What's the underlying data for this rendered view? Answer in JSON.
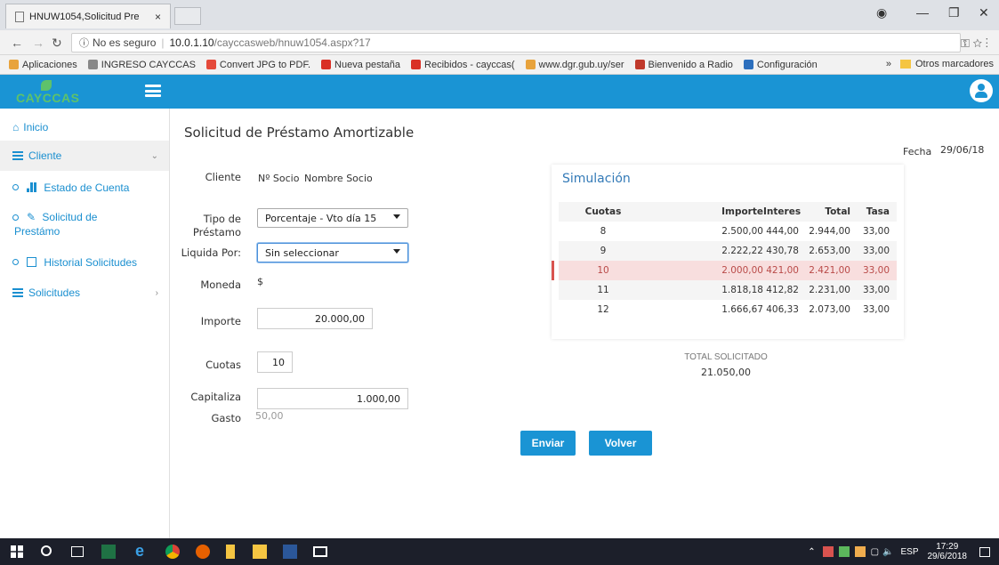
{
  "browser": {
    "tab_title": "HNUW1054,Solicitud Pre",
    "tab_close": "×",
    "security_label": "No es seguro",
    "url_host": "10.0.1.10",
    "url_path": "/cayccasweb/hnuw1054.aspx?17",
    "bookmarks": [
      {
        "label": "Aplicaciones",
        "color": "#e8a33c"
      },
      {
        "label": "INGRESO CAYCCAS",
        "color": "#888888"
      },
      {
        "label": "Convert JPG to PDF.",
        "color": "#e54a3a"
      },
      {
        "label": "Nueva pestaña",
        "color": "#d93025"
      },
      {
        "label": "Recibidos - cayccas(",
        "color": "#d93025"
      },
      {
        "label": "www.dgr.gub.uy/ser",
        "color": "#e8a33c"
      },
      {
        "label": "Bienvenido a Radio",
        "color": "#c0392b"
      },
      {
        "label": "Configuración",
        "color": "#2c6fbd"
      }
    ],
    "bookmarks_overflow": "»",
    "other_bookmarks": "Otros marcadores"
  },
  "app": {
    "logo": "CAYCCAS",
    "brand_color": "#1a94d4"
  },
  "sidebar": {
    "inicio": "Inicio",
    "cliente": "Cliente",
    "estado_cuenta": "Estado de Cuenta",
    "solicitud_prestamo_1": "Solicitud de",
    "solicitud_prestamo_2": "Prestámo",
    "historial": "Historial Solicitudes",
    "solicitudes": "Solicitudes"
  },
  "main": {
    "title": "Solicitud de Préstamo Amortizable",
    "fecha_label": "Fecha",
    "fecha_value": "29/06/18",
    "cliente_label": "Cliente",
    "socio_num": "Nº Socio",
    "socio_nombre": "Nombre Socio",
    "tipo_label_1": "Tipo de",
    "tipo_label_2": "Préstamo",
    "tipo_value": "Porcentaje - Vto día 15",
    "liquida_label": "Liquida Por:",
    "liquida_value": "Sin seleccionar",
    "moneda_label": "Moneda",
    "moneda_value": "$",
    "importe_label": "Importe",
    "importe_value": "20.000,00",
    "cuotas_label": "Cuotas",
    "cuotas_value": "10",
    "capitaliza_label": "Capitaliza",
    "capitaliza_value": "1.000,00",
    "gasto_label": "Gasto",
    "gasto_value": "50,00",
    "total_label": "TOTAL SOLICITADO",
    "total_value": "21.050,00",
    "enviar": "Enviar",
    "volver": "Volver"
  },
  "simulation": {
    "title": "Simulación",
    "headers": {
      "cuotas": "Cuotas",
      "importe": "Importe",
      "interes": "Interes",
      "total": "Total",
      "tasa": "Tasa"
    },
    "rows": [
      {
        "cuotas": "8",
        "importe": "2.500,00",
        "interes": "444,00",
        "total": "2.944,00",
        "tasa": "33,00"
      },
      {
        "cuotas": "9",
        "importe": "2.222,22",
        "interes": "430,78",
        "total": "2.653,00",
        "tasa": "33,00"
      },
      {
        "cuotas": "10",
        "importe": "2.000,00",
        "interes": "421,00",
        "total": "2.421,00",
        "tasa": "33,00"
      },
      {
        "cuotas": "11",
        "importe": "1.818,18",
        "interes": "412,82",
        "total": "2.231,00",
        "tasa": "33,00"
      },
      {
        "cuotas": "12",
        "importe": "1.666,67",
        "interes": "406,33",
        "total": "2.073,00",
        "tasa": "33,00"
      }
    ]
  },
  "taskbar": {
    "lang": "ESP",
    "time": "17:29",
    "date": "29/6/2018"
  }
}
